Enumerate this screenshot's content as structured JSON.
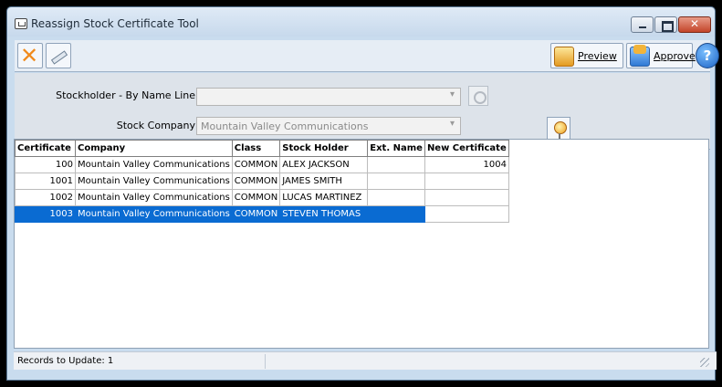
{
  "window": {
    "title": "Reassign Stock Certificate Tool"
  },
  "toolbar": {
    "preview_label": "Preview",
    "approve_label": "Approve",
    "help_label": "?"
  },
  "filters": {
    "stockholder_label": "Stockholder - By Name Line",
    "stockholder_value": "",
    "company_label": "Stock Company",
    "company_value": "Mountain Valley Communications"
  },
  "grid": {
    "columns": [
      "Certificate",
      "Company",
      "Class",
      "Stock Holder",
      "Ext. Name",
      "New Certificate"
    ],
    "rows": [
      {
        "certificate": "100",
        "company": "Mountain Valley Communications",
        "class": "COMMON",
        "holder": "ALEX JACKSON",
        "ext_name": "",
        "new_certificate": "1004"
      },
      {
        "certificate": "1001",
        "company": "Mountain Valley Communications",
        "class": "COMMON",
        "holder": "JAMES SMITH",
        "ext_name": "",
        "new_certificate": ""
      },
      {
        "certificate": "1002",
        "company": "Mountain Valley Communications",
        "class": "COMMON",
        "holder": "LUCAS  MARTINEZ",
        "ext_name": "",
        "new_certificate": ""
      },
      {
        "certificate": "1003",
        "company": "Mountain Valley Communications",
        "class": "COMMON",
        "holder": "STEVEN THOMAS",
        "ext_name": "",
        "new_certificate": ""
      }
    ],
    "selected_row": 3
  },
  "status": {
    "records_text": "Records to Update: 1"
  },
  "colors": {
    "selection": "#0a6bd2",
    "accent_orange": "#f08a1c",
    "title_bg": "#c7d9ec"
  },
  "icons": {
    "delete": "x-icon",
    "edit": "pencil-icon",
    "preview": "preview-icon",
    "approve": "approve-icon",
    "help": "help-icon",
    "pin": "pin-icon"
  }
}
